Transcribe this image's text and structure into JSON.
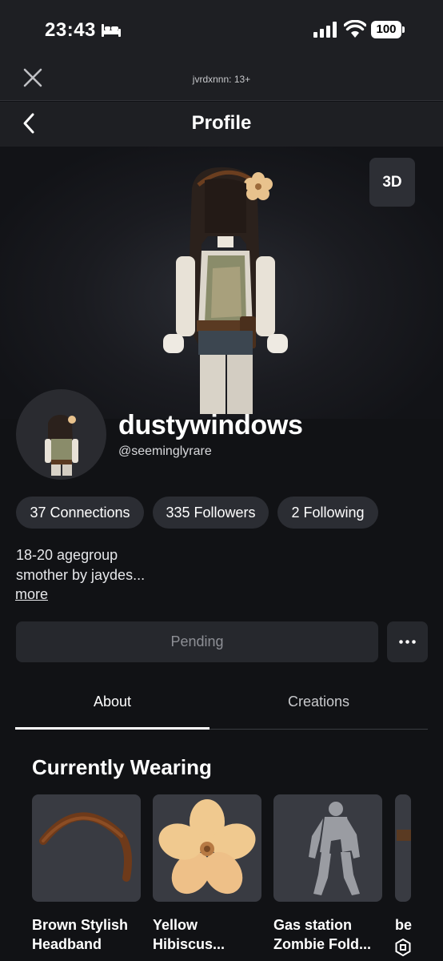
{
  "status_bar": {
    "time": "23:43",
    "battery": "100"
  },
  "web_header": {
    "url_text": "jvrdxnnn: 13+"
  },
  "nav": {
    "title": "Profile"
  },
  "hero": {
    "view_toggle": "3D"
  },
  "profile": {
    "display_name": "dustywindows",
    "username": "@seeminglyrare",
    "stats": {
      "connections": "37 Connections",
      "followers": "335 Followers",
      "following": "2 Following"
    },
    "bio": [
      "18-20 agegroup",
      "smother by jaydes..."
    ],
    "more_label": "more"
  },
  "actions": {
    "pending_label": "Pending"
  },
  "tabs": [
    "About",
    "Creations"
  ],
  "wearing": {
    "title": "Currently Wearing",
    "items": [
      {
        "name_line1": "Brown Stylish",
        "name_line2": "Headband"
      },
      {
        "name_line1": "Yellow",
        "name_line2": "Hibiscus..."
      },
      {
        "name_line1": "Gas station",
        "name_line2": "Zombie Fold..."
      },
      {
        "name_line1": "be"
      }
    ]
  },
  "colors": {
    "background": "#111215",
    "surface": "#2b2d33",
    "header": "#1e1f23",
    "muted_text": "#8d8f95"
  },
  "icons": [
    "bed-icon",
    "signal-icon",
    "wifi-icon",
    "battery-icon",
    "close-icon",
    "chevron-left-icon",
    "ellipsis-icon",
    "robux-icon"
  ]
}
